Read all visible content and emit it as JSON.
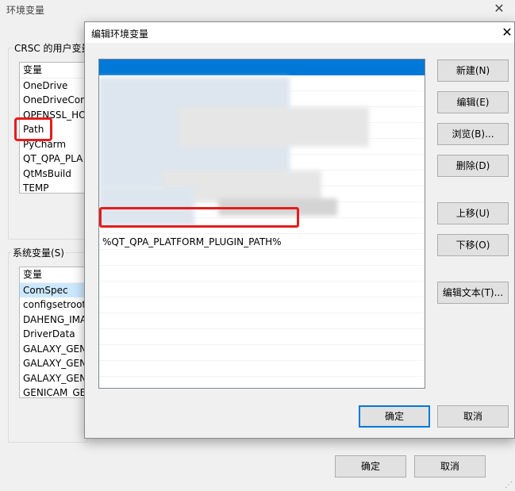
{
  "parent": {
    "title": "环境变量",
    "close_glyph": "✕",
    "user_group_label": "CRSC 的用户变量",
    "system_group_label": "系统变量(S)",
    "user_vars": [
      "变量",
      "OneDrive",
      "OneDriveCon",
      "OPENSSL_HO",
      "Path",
      "PyCharm",
      "QT_QPA_PLA",
      "QtMsBuild",
      "TEMP"
    ],
    "system_vars": [
      "变量",
      "ComSpec",
      "configsetroot",
      "DAHENG_IMA",
      "DriverData",
      "GALAXY_GEN",
      "GALAXY_GEN",
      "GALAXY_GEN",
      "GENICAM_GE"
    ],
    "ok_label": "确定",
    "cancel_label": "取消"
  },
  "dialog": {
    "title": "编辑环境变量",
    "close_glyph": "✕",
    "visible_entry": "%QT_QPA_PLATFORM_PLUGIN_PATH%",
    "buttons": {
      "new": "新建(N)",
      "edit": "编辑(E)",
      "browse": "浏览(B)...",
      "delete": "删除(D)",
      "move_up": "上移(U)",
      "move_down": "下移(O)",
      "edit_text": "编辑文本(T)...",
      "ok": "确定",
      "cancel": "取消"
    }
  },
  "colors": {
    "highlight_red": "#e81b1b",
    "selection_blue": "#0078d7",
    "default_button_border": "#0078d7"
  }
}
